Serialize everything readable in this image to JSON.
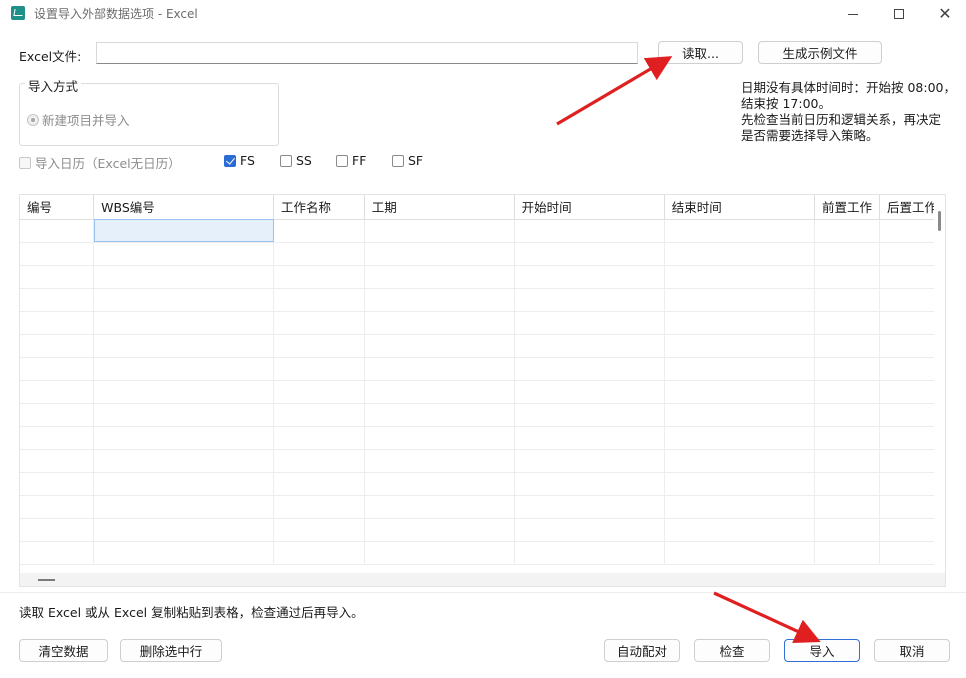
{
  "window": {
    "title": "设置导入外部数据选项 - Excel"
  },
  "file": {
    "label": "Excel文件:",
    "value": "",
    "read_button": "读取...",
    "sample_button": "生成示例文件"
  },
  "note": {
    "line1": "日期没有具体时间时：开始按 08:00，",
    "line2": "结束按 17:00。",
    "line3": "先检查当前日历和逻辑关系，再决定",
    "line4": "是否需要选择导入策略。"
  },
  "import_mode": {
    "group_label": "导入方式",
    "option": "新建项目并导入"
  },
  "options": {
    "calendar": "导入日历（Excel无日历）",
    "fs": "FS",
    "ss": "SS",
    "ff": "FF",
    "sf": "SF"
  },
  "grid": {
    "columns": [
      "编号",
      "WBS编号",
      "工作名称",
      "工期",
      "开始时间",
      "结束时间",
      "前置工作",
      "后置工作"
    ]
  },
  "hint": "读取 Excel 或从 Excel 复制粘贴到表格，检查通过后再导入。",
  "buttons": {
    "clear": "清空数据",
    "delete_row": "删除选中行",
    "auto_match": "自动配对",
    "check": "检查",
    "import": "导入",
    "cancel": "取消"
  },
  "colors": {
    "accent": "#2b6cd4",
    "annotation_arrow": "#e02020"
  }
}
